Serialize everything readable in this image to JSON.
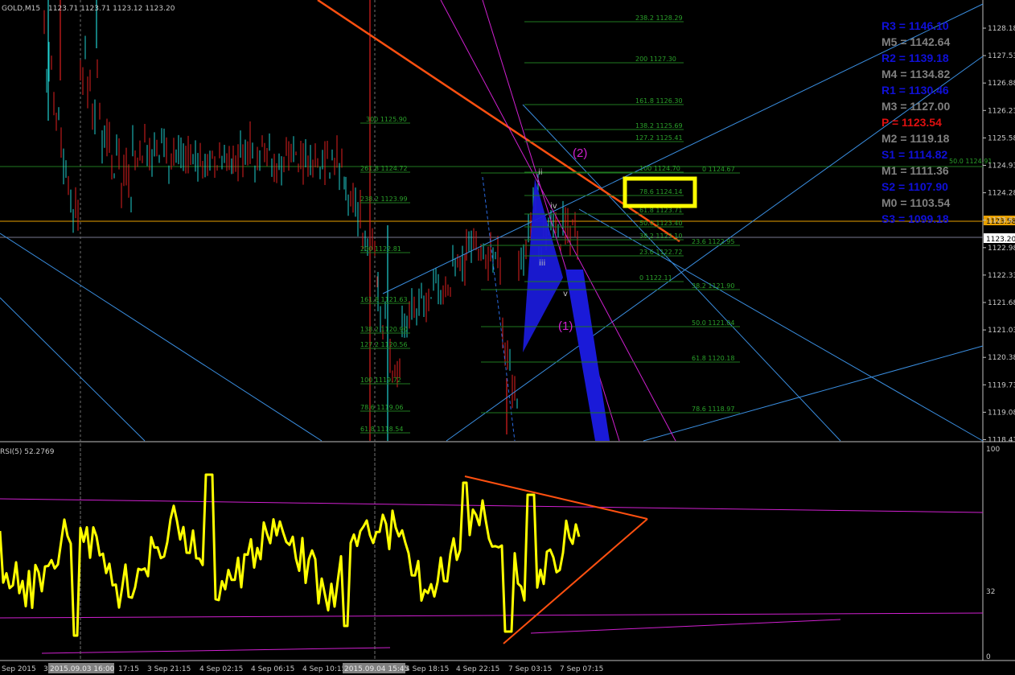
{
  "header": {
    "symbol": "GOLD,M15",
    "ohlc": "1123.71 1123.71 1123.12 1123.20"
  },
  "price_axis": {
    "ticks": [
      "1128.18",
      "1127.53",
      "1126.88",
      "1126.23",
      "1125.58",
      "1124.93",
      "1124.28",
      "1123.63",
      "1122.98",
      "1122.33",
      "1121.68",
      "1121.03",
      "1120.38",
      "1119.73",
      "1119.08",
      "1118.43"
    ],
    "current_bid": "1123.20",
    "pivot_level": "1123.58"
  },
  "rsi_axis": {
    "label": "RSI(5) 52.2769",
    "ticks": [
      "100",
      "32",
      "0"
    ]
  },
  "time_axis": {
    "labels": [
      "Sep 2015",
      "3",
      "2015.09.03 16:00",
      "17:15",
      "3 Sep 21:15",
      "4 Sep 02:15",
      "4 Sep 06:15",
      "4 Sep 10:15",
      "2015.09.04 15:45",
      "4 Sep 18:15",
      "4 Sep 22:15",
      "7 Sep 03:15",
      "7 Sep 07:15"
    ]
  },
  "pivots": [
    {
      "label": "R3 = 1146.10",
      "color": "#1010d8"
    },
    {
      "label": "M5 = 1142.64",
      "color": "#808080"
    },
    {
      "label": "R2 = 1139.18",
      "color": "#1010d8"
    },
    {
      "label": "M4 = 1134.82",
      "color": "#808080"
    },
    {
      "label": "R1 = 1130.46",
      "color": "#1010d8"
    },
    {
      "label": "M3 = 1127.00",
      "color": "#808080"
    },
    {
      "label": "P  = 1123.54",
      "color": "#e01010"
    },
    {
      "label": "M2 = 1119.18",
      "color": "#808080"
    },
    {
      "label": "S1 = 1114.82",
      "color": "#1010d8"
    },
    {
      "label": "M1 = 1111.36",
      "color": "#808080"
    },
    {
      "label": "S2 = 1107.90",
      "color": "#1010d8"
    },
    {
      "label": "M0 = 1103.54",
      "color": "#808080"
    },
    {
      "label": "S3 = 1099.18",
      "color": "#1010d8"
    }
  ],
  "fib_right": [
    "238.2 1128.29",
    "200 1127.30",
    "161.8 1126.30",
    "138.2 1125.69",
    "127.2 1125.41",
    "100 1124.70",
    "78.6 1124.14",
    "61.8 1123.71",
    "50.0 1123.40",
    "38.2 1123.10",
    "23.6 1122.72",
    "0 1122.11"
  ],
  "fib_retr": [
    "0 1124.67",
    "23.6 1122.95",
    "38.2 1121.90",
    "50.0 1121.04",
    "61.8 1120.18",
    "78.6 1118.97"
  ],
  "fib_left": [
    "300 1125.90",
    "261.8 1124.72",
    "238.2 1123.99",
    "200 1122.81",
    "161.8 1121.63",
    "138.2 1120.90",
    "127.2 1120.56",
    "100 1119.72",
    "78.6 1119.06",
    "61.8 1118.54"
  ],
  "fib_far": "50.0 1124.91",
  "waves": {
    "major": [
      "(2)",
      "(1)"
    ],
    "minor": [
      "iv",
      "iii",
      "v",
      "ii"
    ]
  },
  "colors": {
    "background": "#000000",
    "bull": "#20d0d0",
    "bear": "#e02020",
    "rsi": "#ffff00",
    "highlight": "#ffff00",
    "trend_orange": "#ff5010",
    "channel_blue": "#3a8ee0",
    "magenta": "#d020d0",
    "wedge": "#1a1ad8"
  },
  "chart_data": {
    "type": "candlestick",
    "symbol": "GOLD",
    "timeframe": "M15",
    "last_close": 1123.2,
    "y_range": [
      1118.43,
      1128.5
    ],
    "indicator": {
      "name": "RSI(5)",
      "last": 52.2769,
      "range": [
        0,
        100
      ]
    }
  }
}
